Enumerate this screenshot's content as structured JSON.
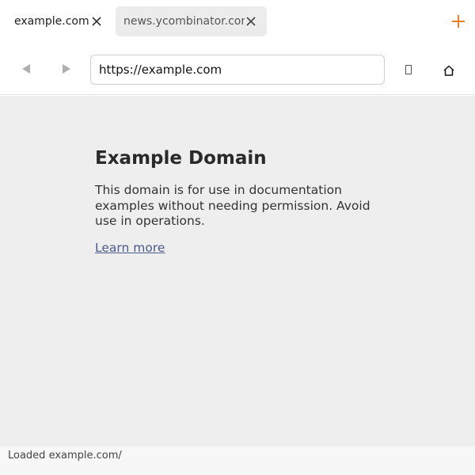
{
  "tabs": [
    {
      "title": "example.com",
      "active": true
    },
    {
      "title": "news.ycombinator.com",
      "active": false
    }
  ],
  "toolbar": {
    "url": "https://example.com",
    "bookmark_glyph": "▯",
    "icons": {
      "back": "back-arrow-icon",
      "forward": "forward-arrow-icon",
      "home": "home-icon",
      "new_tab": "plus-icon",
      "tab_close": "close-icon"
    }
  },
  "page": {
    "heading": "Example Domain",
    "body": "This domain is for use in documentation examples without needing permission. Avoid use in operations.",
    "link_text": "Learn more"
  },
  "status": {
    "text": "Loaded example.com/"
  },
  "colors": {
    "accent": "#e8730c",
    "viewport_bg": "#eeeeee",
    "inactive_tab_bg": "#ececec",
    "link": "#4a5a8a"
  }
}
